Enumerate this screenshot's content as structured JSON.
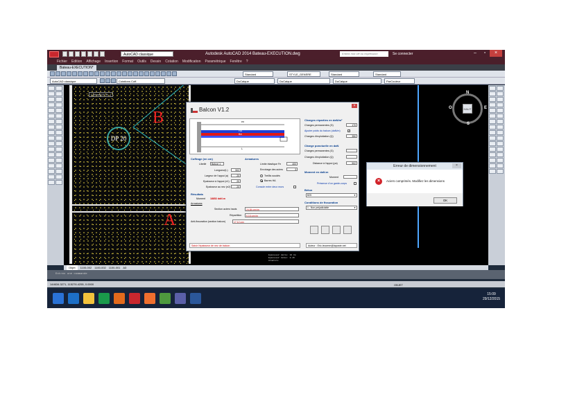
{
  "titlebar": {
    "workspace": "AutoCAD classique",
    "app_title": "Autodesk AutoCAD 2014    Bateau-EXECUTION.dwg",
    "search_placeholder": "Entrez mot clé ou expression",
    "signin": "Se connecter"
  },
  "menu": [
    "Fichier",
    "Edition",
    "Affichage",
    "Insertion",
    "Format",
    "Outils",
    "Dessin",
    "Cotation",
    "Modification",
    "Paramétrique",
    "Fenêtre",
    "?"
  ],
  "doc_tab": "Bateau-EXECUTION*",
  "toolbar": {
    "textstyle": "Standard",
    "dimstyle": "STYLE_GENERE",
    "tablestyle": "Standard",
    "mleaderstyle": "Standard",
    "workspace2": "AutoCAD classique",
    "layer": "Cotations Coff.",
    "color": "DuCalque",
    "linetype": "DuCalque",
    "lineweight": "DuCalque",
    "plotstyle": "ParCouleur"
  },
  "canvas": {
    "viewport_label": "[-][Haut][2D fil...]",
    "letter_b": "B",
    "letter_a": "A",
    "dp_label": "DP 20",
    "compass": {
      "n": "N",
      "s": "S",
      "e": "E",
      "o": "O",
      "hub": "HAUT"
    },
    "info_lines": [
      "Epaisseur dalle: 16 Cm",
      "Epaisseur béton: 8.15",
      "Armature"
    ]
  },
  "layout_tabs": [
    "Objet",
    "1100-002",
    "1100-002",
    "1100-001",
    "A3"
  ],
  "cmdline": "Entrez une commande",
  "status_coords": "144634.3271, 115276.4255, 0.0000",
  "status_model": "OBJET",
  "clock": {
    "time": "15:09",
    "date": "29/12/2015"
  },
  "balcon": {
    "title": "Balcon V1.2",
    "sketch_labels": {
      "span": "L",
      "top": "en",
      "ba": "BA",
      "ha": "HA"
    },
    "coffrage": {
      "section": "Coffrage (en cm)",
      "libelle_label": "Libellé",
      "libelle": "Balcon 1",
      "longueur_label": "Longueur(L)",
      "longueur": "502",
      "largeur_label": "Largeur de l'appui (a)",
      "largeur": "20",
      "ep_appui_label": "Epaisseur à l'appui (e1)",
      "ep_appui": "20",
      "ep_nez_label": "Epaisseur au nez (e2)",
      "ep_nez": "20"
    },
    "armatures": {
      "section": "Armatures",
      "fe_label": "Limite élastique Fe",
      "fe": "400",
      "enrob_label": "Enrobage des aciers",
      "enrob": "3",
      "treillis_label": "Treillis soudés",
      "barres_label": "Barres HA",
      "console_label": "Console entre deux murs"
    },
    "charges_reparties": {
      "section": "Charges réparties en daN/m²",
      "g_label": "Charges permanentes (G)",
      "g": "170",
      "pp_label": "Ajouter poids du balcon (daN/m)",
      "q_label": "Charges d'exploitation (Q)",
      "q": "350"
    },
    "charges_ponctuelles": {
      "section": "Charge ponctuelle en daN",
      "g_label": "Charges permanentes (G)",
      "g": "",
      "q_label": "Charges d'exploitation (Q)",
      "q": "",
      "dist_label": "Distance à l'appui (pa)",
      "dist": "502"
    },
    "moment": {
      "section": "Moment en daN.m",
      "label": "Moment",
      "value": "",
      "garde_label": "Présence d'un garde-corps"
    },
    "beton": {
      "section": "Béton",
      "value": "B25"
    },
    "fissuration": {
      "section": "Conditions de fissuration",
      "value": "1 - Non préjudiciable"
    },
    "resultats": {
      "section": "Résultats",
      "moment_label": "Moment",
      "moment_value": "18852 daN.m",
      "armatures_title": "Armatures",
      "aciers_hauts_label": "Section aciers hauts",
      "aciers_hauts": "24,84 cm²/m",
      "repartition_label": "Répartition",
      "repartition": "6,16 cm²/m",
      "anti_label": "Anti-fissuration (section balcon)",
      "anti": "17,12 cm²"
    },
    "status": "Saisir l'épaisseur de nez de balcon",
    "author": "Auteur : Eric.lecomm@laposte.net"
  },
  "error_dialog": {
    "title": "Erreur de dimensionnement",
    "message": "Aciers comprimés. Modifiez les dimensions",
    "ok": "OK"
  },
  "colors": {
    "autocad_red": "#c8272e",
    "drawing_bg": "#000000",
    "hatch": "#ffe94a",
    "axis_blue": "#4fa7ff",
    "error_red": "#d2232a"
  }
}
